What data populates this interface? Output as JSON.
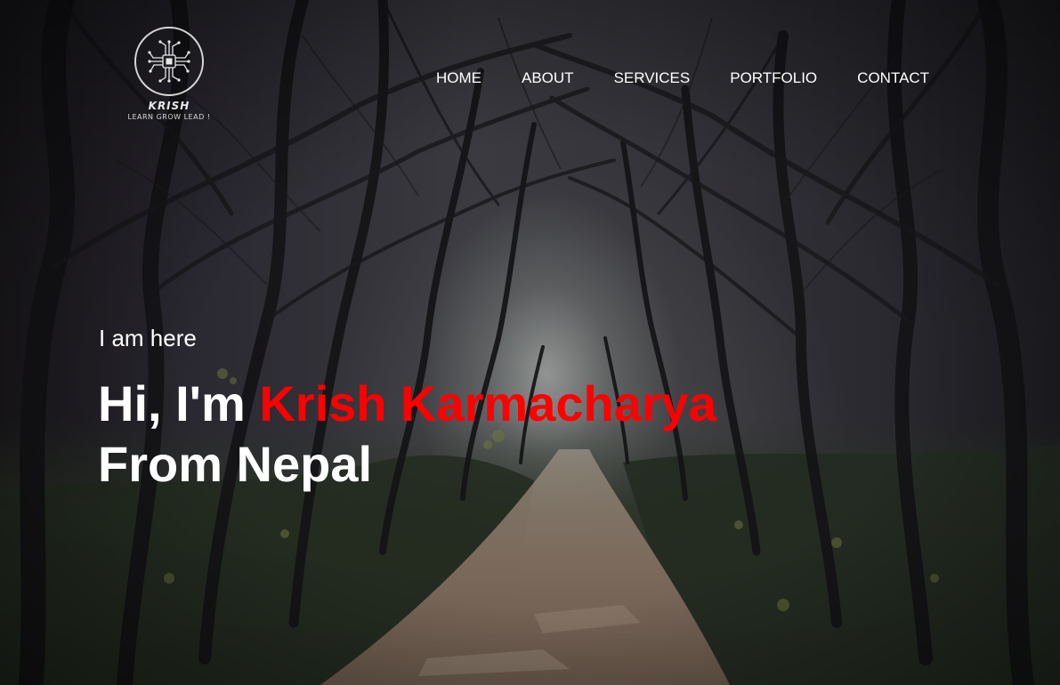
{
  "logo": {
    "name": "KRISH",
    "tagline": "LEARN GROW LEAD !"
  },
  "nav": {
    "items": [
      {
        "label": "HOME"
      },
      {
        "label": "ABOUT"
      },
      {
        "label": "SERVICES"
      },
      {
        "label": "PORTFOLIO"
      },
      {
        "label": "CONTACT"
      }
    ]
  },
  "hero": {
    "intro": "I am here",
    "greeting": "Hi, I'm ",
    "name": "Krish Karmacharya",
    "origin": "From Nepal"
  },
  "colors": {
    "accent": "#ff0000",
    "text": "#ffffff"
  },
  "icons": {
    "logo_mark": "circuit-chip-icon"
  }
}
